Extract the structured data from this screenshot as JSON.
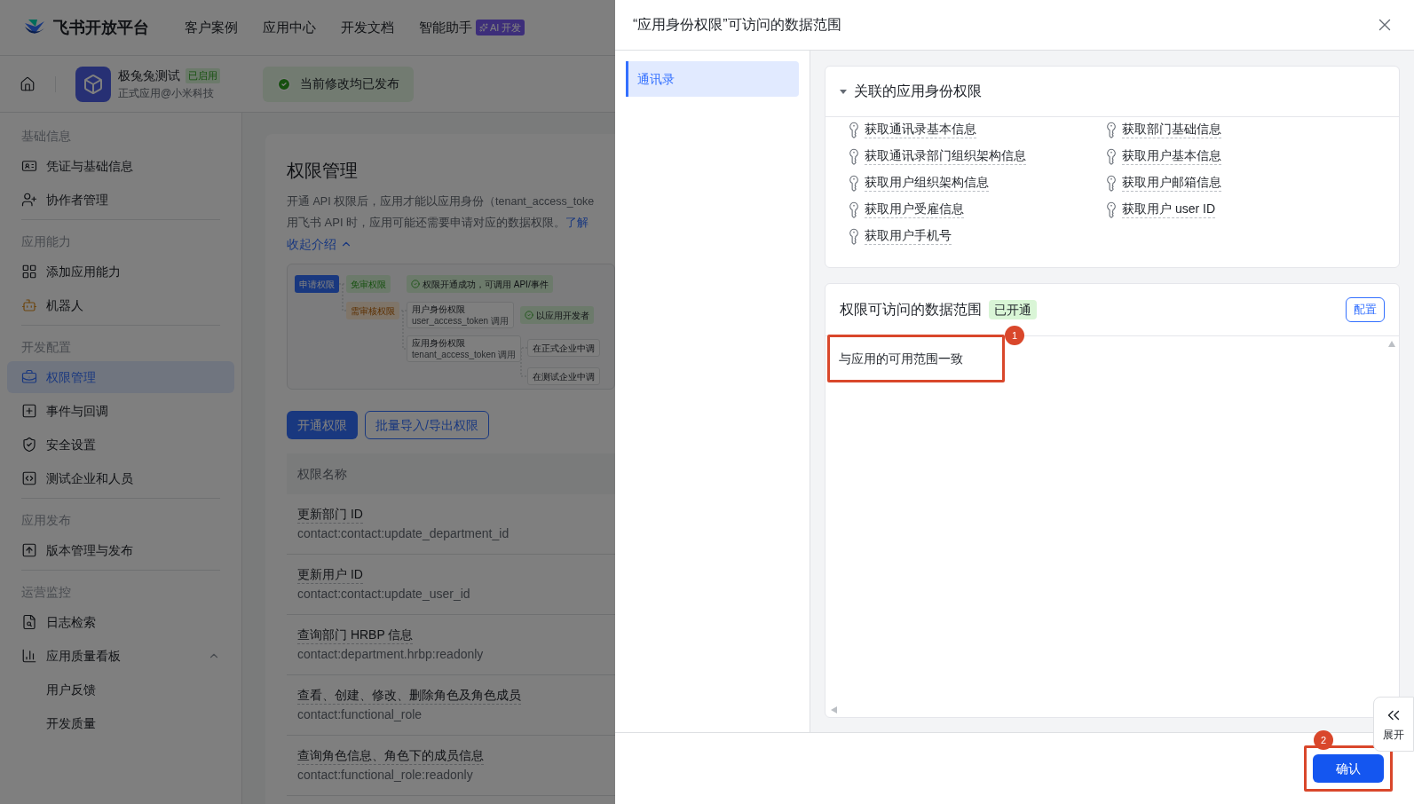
{
  "nav": {
    "brand": "飞书开放平台",
    "links": [
      "客户案例",
      "应用中心",
      "开发文档",
      "智能助手"
    ],
    "ai_badge": "AI 开发"
  },
  "app_header": {
    "app_name": "极兔兔测试",
    "status": "已启用",
    "subtitle": "正式应用@小米科技",
    "publish_notice": "当前修改均已发布"
  },
  "sidebar": {
    "sections": [
      {
        "title": "基础信息",
        "items": [
          {
            "label": "凭证与基础信息",
            "selected": false
          },
          {
            "label": "协作者管理",
            "selected": false
          }
        ]
      },
      {
        "title": "应用能力",
        "items": [
          {
            "label": "添加应用能力",
            "selected": false
          },
          {
            "label": "机器人",
            "selected": false
          }
        ]
      },
      {
        "title": "开发配置",
        "items": [
          {
            "label": "权限管理",
            "selected": true
          },
          {
            "label": "事件与回调",
            "selected": false
          },
          {
            "label": "安全设置",
            "selected": false
          },
          {
            "label": "测试企业和人员",
            "selected": false
          }
        ]
      },
      {
        "title": "应用发布",
        "items": [
          {
            "label": "版本管理与发布",
            "selected": false
          }
        ]
      },
      {
        "title": "运营监控",
        "items": [
          {
            "label": "日志检索",
            "selected": false
          },
          {
            "label": "应用质量看板",
            "selected": false,
            "expanded": true,
            "children": [
              {
                "label": "用户反馈",
                "selected": false
              },
              {
                "label": "开发质量",
                "selected": false
              }
            ]
          }
        ]
      }
    ]
  },
  "main": {
    "title": "权限管理",
    "description": [
      "开通 API 权限后，应用才能以应用身份（tenant_access_toke",
      "用飞书 API 时，应用可能还需要申请对应的数据权限。"
    ],
    "learn_more": "了解",
    "collapse": "收起介绍",
    "diagram": {
      "start": "申请权限",
      "free": "免审权限",
      "success": "权限开通成功，可调用 API/事件",
      "review": "需审核权限",
      "user_perm": "用户身份权限",
      "user_token": "user_access_token 调用",
      "user_next": "以应用开发者",
      "app_perm": "应用身份权限",
      "app_token": "tenant_access_token 调用",
      "prod": "在正式企业中调",
      "test": "在测试企业中调"
    },
    "buttons": {
      "primary": "开通权限",
      "secondary": "批量导入/导出权限"
    },
    "table": {
      "columns": [
        "权限名称"
      ],
      "rows": [
        {
          "name": "更新部门 ID",
          "scope": "contact:contact:update_department_id"
        },
        {
          "name": "更新用户 ID",
          "scope": "contact:contact:update_user_id"
        },
        {
          "name": "查询部门 HRBP 信息",
          "scope": "contact:department.hrbp:readonly"
        },
        {
          "name": "查看、创建、修改、删除角色及角色成员",
          "scope": "contact:functional_role"
        },
        {
          "name": "查询角色信息、角色下的成员信息",
          "scope": "contact:functional_role:readonly"
        }
      ]
    }
  },
  "drawer": {
    "title": "“应用身份权限”可访问的数据范围",
    "tabs": [
      {
        "label": "通讯录",
        "selected": true
      }
    ],
    "related": {
      "title": "关联的应用身份权限",
      "expanded": true,
      "permissions": [
        "获取通讯录基本信息",
        "获取部门基础信息",
        "获取通讯录部门组织架构信息",
        "获取用户基本信息",
        "获取用户组织架构信息",
        "获取用户邮箱信息",
        "获取用户受雇信息",
        "获取用户 user ID",
        "获取用户手机号"
      ]
    },
    "scope": {
      "title": "权限可访问的数据范围",
      "status": "已开通",
      "config": "配置",
      "value": "与应用的可用范围一致",
      "callout": "1"
    },
    "confirm": "确认",
    "confirm_callout": "2",
    "expand_tab": "展开"
  }
}
